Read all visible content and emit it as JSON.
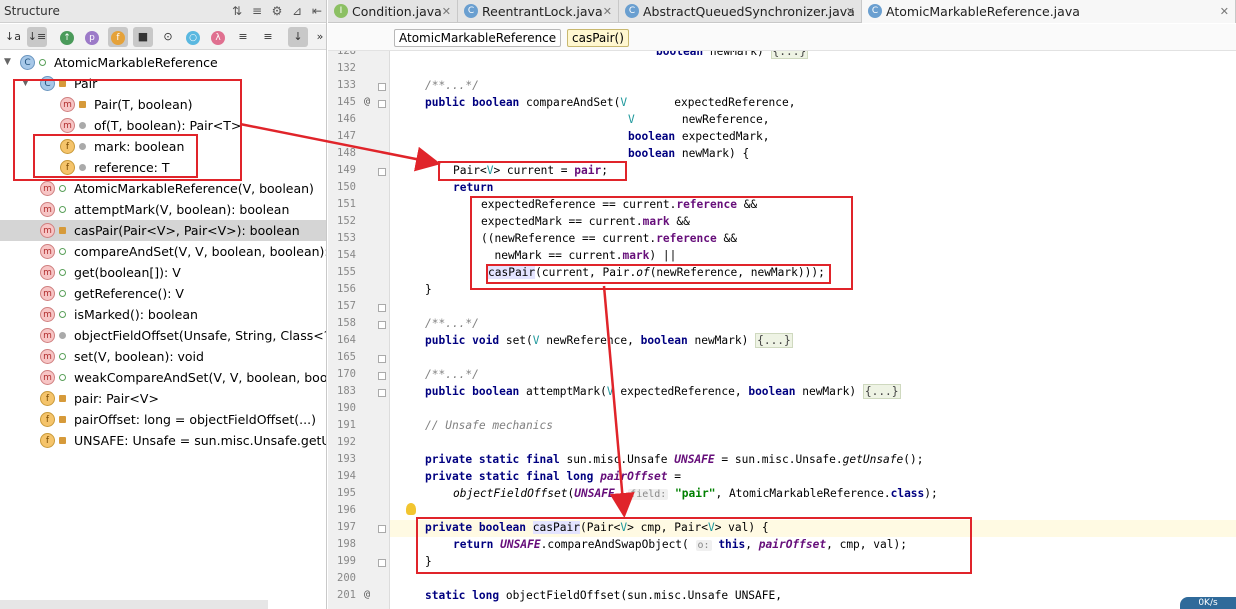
{
  "structure": {
    "title": "Structure",
    "tree": [
      {
        "label": "AtomicMarkableReference",
        "icon": "c",
        "vis": "pub",
        "indent": 0,
        "expanded": true
      },
      {
        "label": "Pair",
        "icon": "c",
        "vis": "lock",
        "indent": 1,
        "expanded": true
      },
      {
        "label": "Pair(T, boolean)",
        "icon": "m",
        "vis": "lock",
        "indent": 2
      },
      {
        "label": "of(T, boolean): Pair<T>",
        "icon": "m",
        "vis": "dot",
        "indent": 2
      },
      {
        "label": "mark: boolean",
        "icon": "f",
        "vis": "dot",
        "indent": 2
      },
      {
        "label": "reference: T",
        "icon": "f",
        "vis": "dot",
        "indent": 2
      },
      {
        "label": "AtomicMarkableReference(V, boolean)",
        "icon": "m",
        "vis": "pub",
        "indent": 1
      },
      {
        "label": "attemptMark(V, boolean): boolean",
        "icon": "m",
        "vis": "pub",
        "indent": 1
      },
      {
        "label": "casPair(Pair<V>, Pair<V>): boolean",
        "icon": "m",
        "vis": "lock",
        "indent": 1,
        "selected": true
      },
      {
        "label": "compareAndSet(V, V, boolean, boolean): boolean",
        "icon": "m",
        "vis": "pub",
        "indent": 1
      },
      {
        "label": "get(boolean[]): V",
        "icon": "m",
        "vis": "pub",
        "indent": 1
      },
      {
        "label": "getReference(): V",
        "icon": "m",
        "vis": "pub",
        "indent": 1
      },
      {
        "label": "isMarked(): boolean",
        "icon": "m",
        "vis": "pub",
        "indent": 1
      },
      {
        "label": "objectFieldOffset(Unsafe, String, Class<?>): long",
        "icon": "m",
        "vis": "dot",
        "indent": 1
      },
      {
        "label": "set(V, boolean): void",
        "icon": "m",
        "vis": "pub",
        "indent": 1
      },
      {
        "label": "weakCompareAndSet(V, V, boolean, boolean): boolean",
        "icon": "m",
        "vis": "pub",
        "indent": 1
      },
      {
        "label": "pair: Pair<V>",
        "icon": "f",
        "vis": "lock",
        "indent": 1
      },
      {
        "label": "pairOffset: long = objectFieldOffset(...)",
        "icon": "f",
        "vis": "lock",
        "indent": 1
      },
      {
        "label": "UNSAFE: Unsafe = sun.misc.Unsafe.getUnsafe()",
        "icon": "f",
        "vis": "lock",
        "indent": 1
      }
    ]
  },
  "tabs": [
    {
      "label": "Condition.java",
      "icon": "I"
    },
    {
      "label": "ReentrantLock.java",
      "icon": "C"
    },
    {
      "label": "AbstractQueuedSynchronizer.java",
      "icon": "C"
    },
    {
      "label": "AtomicMarkableReference.java",
      "icon": "C",
      "active": true
    }
  ],
  "breadcrumb": [
    "AtomicMarkableReference",
    "casPair()"
  ],
  "line_numbers": [
    "128",
    "132",
    "133",
    "145",
    "146",
    "147",
    "148",
    "149",
    "150",
    "151",
    "152",
    "153",
    "154",
    "155",
    "156",
    "157",
    "158",
    "164",
    "165",
    "170",
    "183",
    "190",
    "191",
    "192",
    "193",
    "194",
    "195",
    "196",
    "197",
    "198",
    "199",
    "200",
    "201"
  ],
  "placeholder": "{...}",
  "hints": {
    "field": "field:",
    "o": "o:"
  },
  "corner_text": "0K/s",
  "colors": {
    "annotation": "#e0242a",
    "keyword": "#000080",
    "field": "#660e7a",
    "string": "#008000",
    "comment": "#808080"
  }
}
